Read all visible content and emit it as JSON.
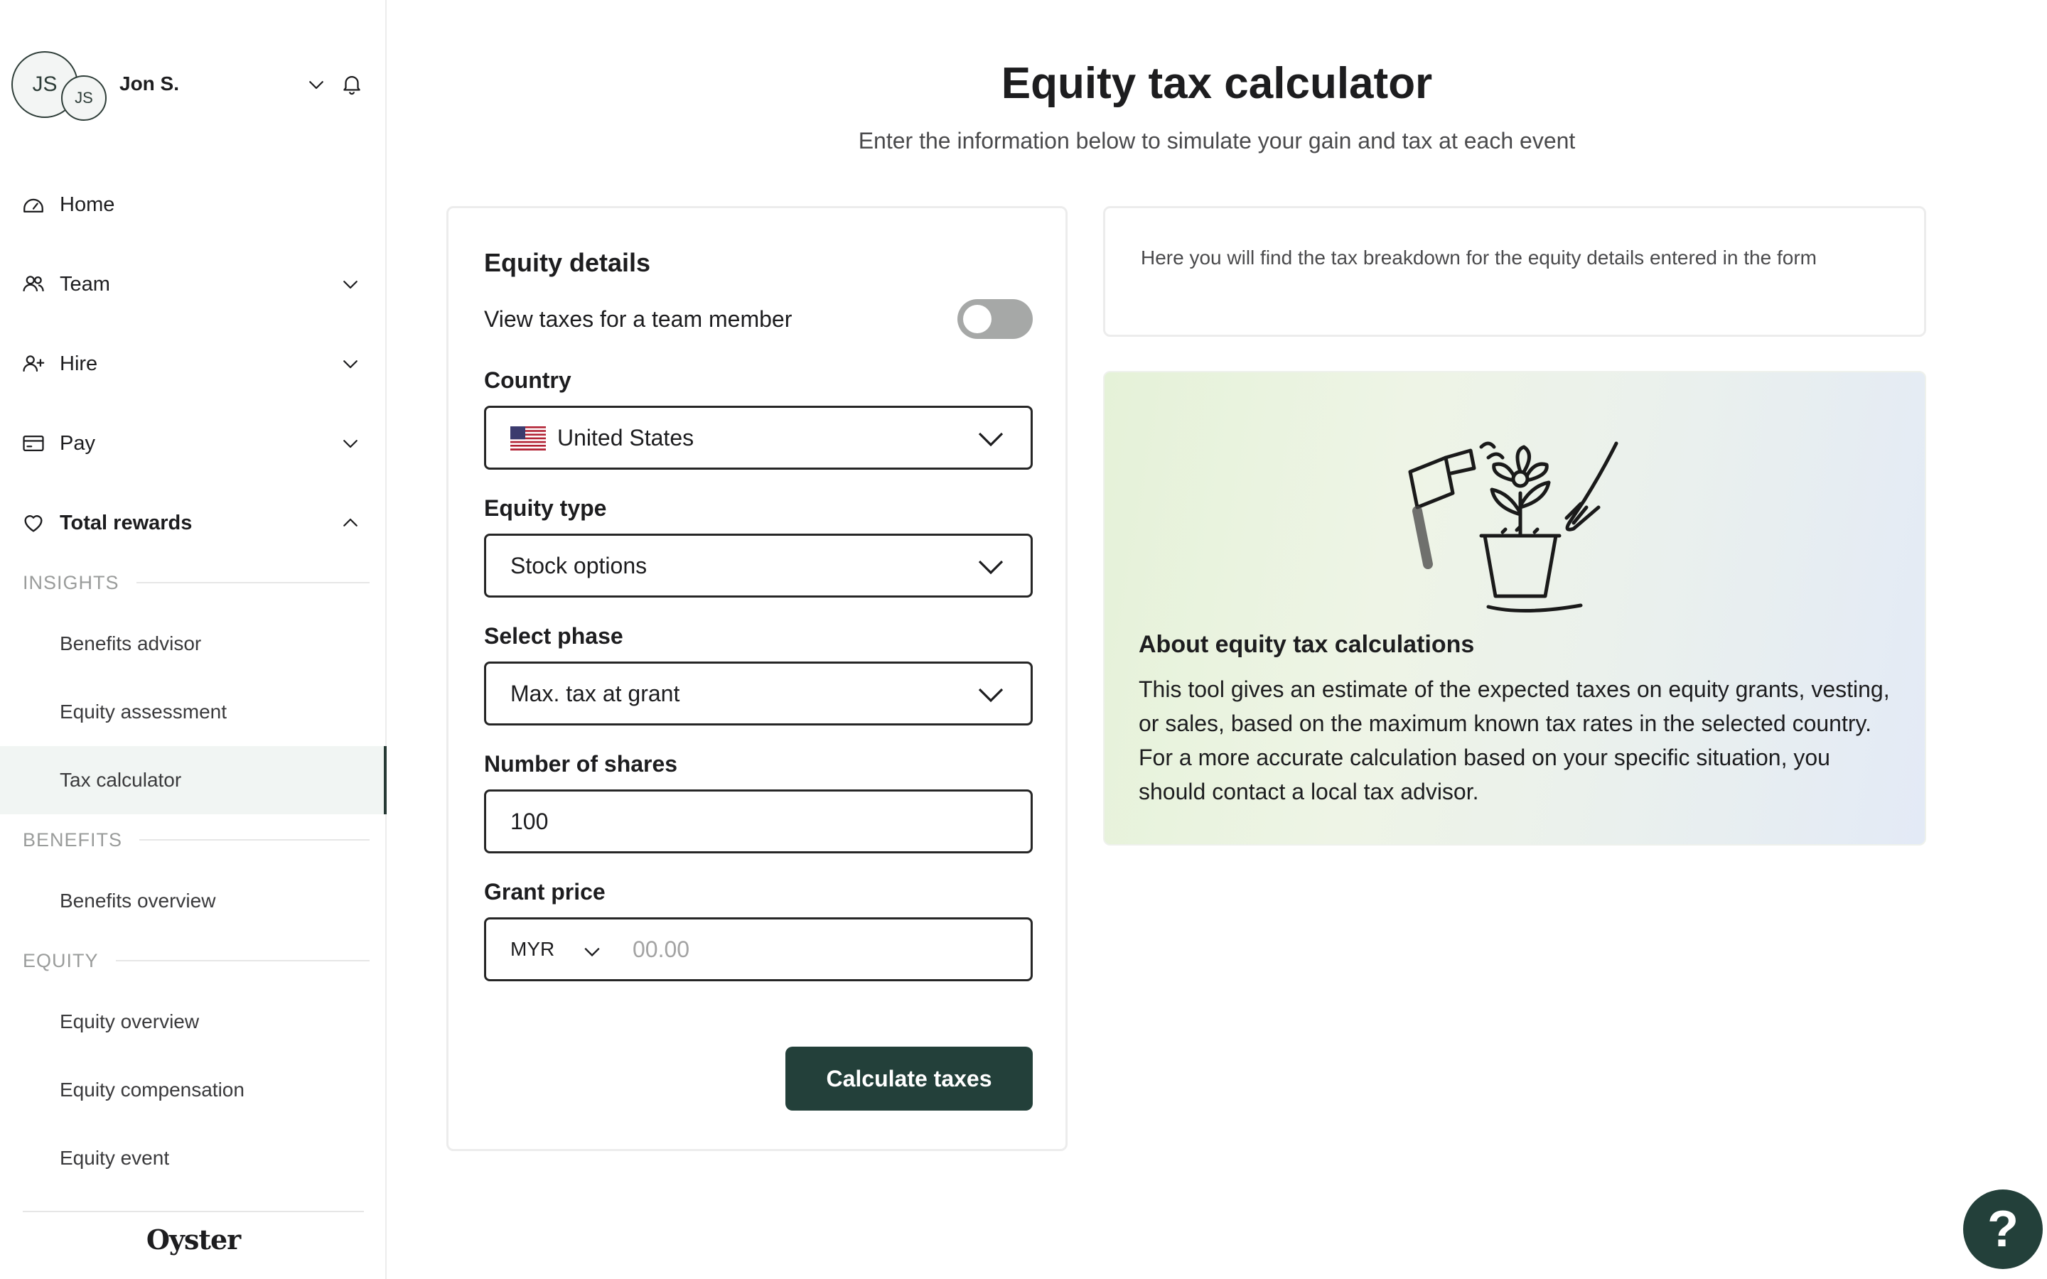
{
  "user": {
    "initials": "JS",
    "name": "Jon S."
  },
  "sidebar": {
    "nav": [
      {
        "label": "Home",
        "icon": "home-dashboard-icon"
      },
      {
        "label": "Team",
        "icon": "team-icon"
      },
      {
        "label": "Hire",
        "icon": "add-person-icon"
      },
      {
        "label": "Pay",
        "icon": "wallet-icon"
      },
      {
        "label": "Total rewards",
        "icon": "heart-icon"
      }
    ],
    "sections": {
      "insights": "INSIGHTS",
      "benefits": "BENEFITS",
      "equity": "EQUITY"
    },
    "sub_items": {
      "benefits_advisor": "Benefits advisor",
      "equity_assessment": "Equity assessment",
      "tax_calculator": "Tax calculator",
      "benefits_overview": "Benefits overview",
      "equity_overview": "Equity overview",
      "equity_compensation": "Equity compensation",
      "equity_event": "Equity event"
    },
    "active_item": "Tax calculator",
    "brand": "Oyster"
  },
  "main": {
    "title": "Equity tax calculator",
    "subtitle": "Enter the information below to simulate your gain and tax at each event"
  },
  "form": {
    "title": "Equity details",
    "toggle_label": "View taxes for a team member",
    "toggle_on": false,
    "country_label": "Country",
    "country_value": "United States",
    "equity_type_label": "Equity type",
    "equity_type_value": "Stock options",
    "phase_label": "Select phase",
    "phase_value": "Max. tax at grant",
    "shares_label": "Number of shares",
    "shares_value": "100",
    "grant_price_label": "Grant price",
    "currency": "MYR",
    "grant_price_placeholder": "00.00",
    "submit_label": "Calculate taxes"
  },
  "breakdown": {
    "text": "Here you will find the tax breakdown for the equity details entered in the form"
  },
  "about": {
    "title": "About equity tax calculations",
    "text": "This tool gives an estimate of the expected taxes on equity grants, vesting, or sales, based on the maximum known tax rates in the selected country. For a more accurate calculation based on your specific situation, you should contact a local tax advisor."
  },
  "help": {
    "label": "?"
  },
  "colors": {
    "brand_dark_green": "#23403a",
    "toggle_off": "#a6a8a7",
    "active_nav_bg": "#f1f5f3"
  }
}
